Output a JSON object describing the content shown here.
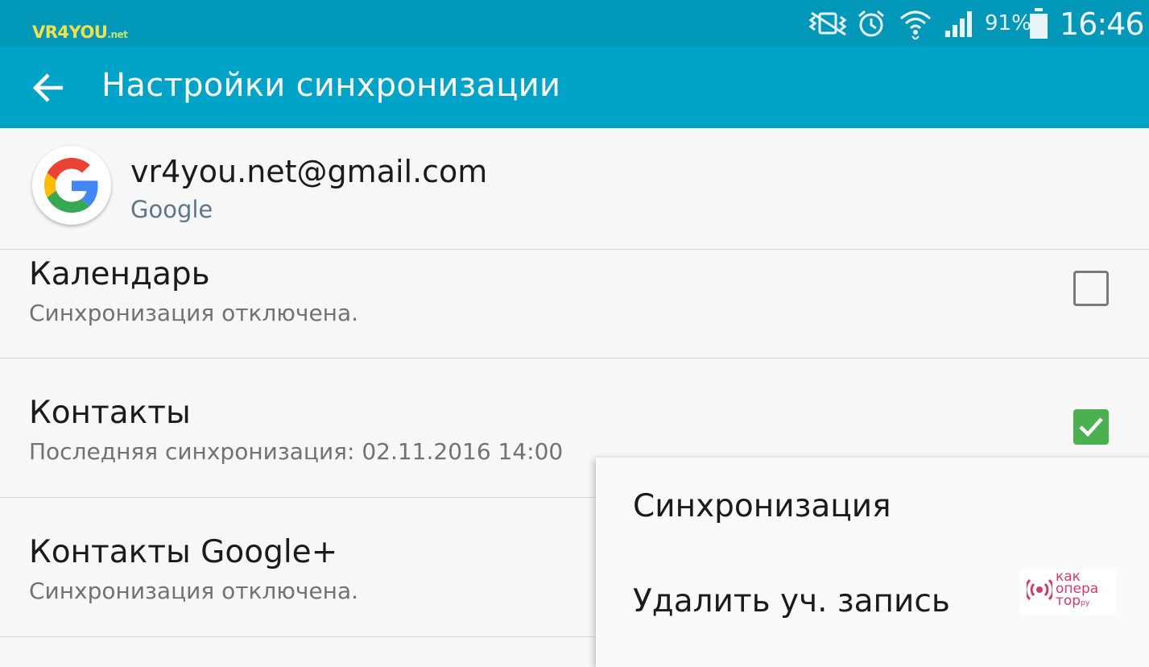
{
  "watermark": {
    "main": "VR4YOU",
    "suffix": ".net"
  },
  "status_bar": {
    "icons": [
      "vibrate-mute-icon",
      "alarm-icon",
      "wifi-icon",
      "signal-icon",
      "battery-icon"
    ],
    "battery_percent": "91%",
    "battery_level": 0.91,
    "time": "16:46"
  },
  "app_bar": {
    "back_icon": "arrow-back-icon",
    "title": "Настройки синхронизации"
  },
  "account": {
    "avatar_icon": "google-g-icon",
    "email": "vr4you.net@gmail.com",
    "type": "Google"
  },
  "sync_items": [
    {
      "title": "Календарь",
      "subtitle": "Синхронизация отключена.",
      "checked": false
    },
    {
      "title": "Контакты",
      "subtitle": "Последняя синхронизация: 02.11.2016 14:00",
      "checked": true
    },
    {
      "title": "Контакты Google+",
      "subtitle": "Синхронизация отключена.",
      "checked": false
    }
  ],
  "menu": {
    "items": [
      "Синхронизация",
      "Удалить уч. запись"
    ]
  },
  "badge": {
    "icon": "radio-waves-icon",
    "lines": [
      "как",
      "опера",
      "тор"
    ],
    "suffix": "ру"
  },
  "colors": {
    "status_bar": "#0097b8",
    "app_bar": "#00a3c8",
    "checkbox_on": "#4caf50",
    "badge": "#d23a6b"
  }
}
